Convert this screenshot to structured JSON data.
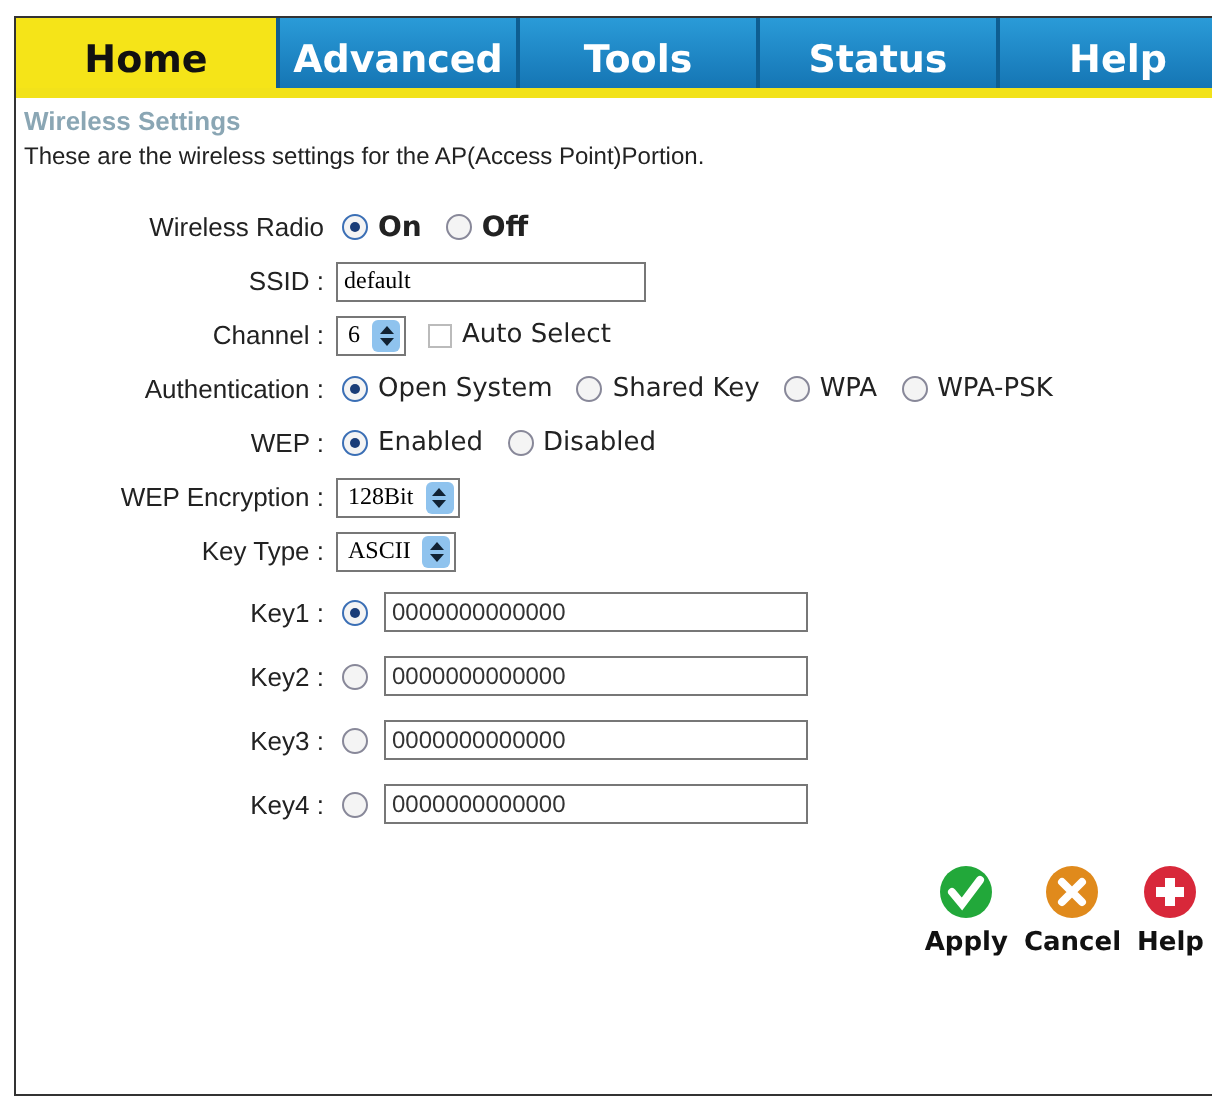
{
  "tabs": [
    {
      "label": "Home",
      "selected": true
    },
    {
      "label": "Advanced",
      "selected": false
    },
    {
      "label": "Tools",
      "selected": false
    },
    {
      "label": "Status",
      "selected": false
    },
    {
      "label": "Help",
      "selected": false
    }
  ],
  "heading": "Wireless Settings",
  "description": "These are the wireless settings for the AP(Access Point)Portion.",
  "fields": [
    {
      "kind": "toggle",
      "label": "Wireless Radio",
      "options": [
        {
          "label": "On",
          "selected": true
        },
        {
          "label": "Off",
          "selected": false
        }
      ]
    },
    {
      "kind": "text",
      "label": "SSID :",
      "value": "default"
    },
    {
      "kind": "select",
      "label": "Channel :",
      "value": "6",
      "checkbox": {
        "label": "Auto Select",
        "checked": false,
        "disabled": true
      }
    },
    {
      "kind": "radio",
      "label": "Authentication :",
      "options": [
        {
          "label": "Open System",
          "selected": true
        },
        {
          "label": "Shared Key",
          "selected": false
        },
        {
          "label": "WPA",
          "selected": false
        },
        {
          "label": "WPA-PSK",
          "selected": false
        }
      ]
    },
    {
      "kind": "radio",
      "label": "WEP :",
      "options": [
        {
          "label": "Enabled",
          "selected": true
        },
        {
          "label": "Disabled",
          "selected": false
        }
      ]
    },
    {
      "kind": "select",
      "label": "WEP Encryption :",
      "value": "128Bit"
    },
    {
      "kind": "select",
      "label": "Key Type :",
      "value": "ASCII"
    },
    {
      "kind": "key",
      "label": "Key1 :",
      "selected": true,
      "value": "0000000000000"
    },
    {
      "kind": "key",
      "label": "Key2 :",
      "selected": false,
      "value": "0000000000000"
    },
    {
      "kind": "key",
      "label": "Key3 :",
      "selected": false,
      "value": "0000000000000"
    },
    {
      "kind": "key",
      "label": "Key4 :",
      "selected": false,
      "value": "0000000000000"
    }
  ],
  "actions": [
    {
      "kind": "apply",
      "label": "Apply"
    },
    {
      "kind": "cancel",
      "label": "Cancel"
    },
    {
      "kind": "help",
      "label": "Help"
    }
  ]
}
